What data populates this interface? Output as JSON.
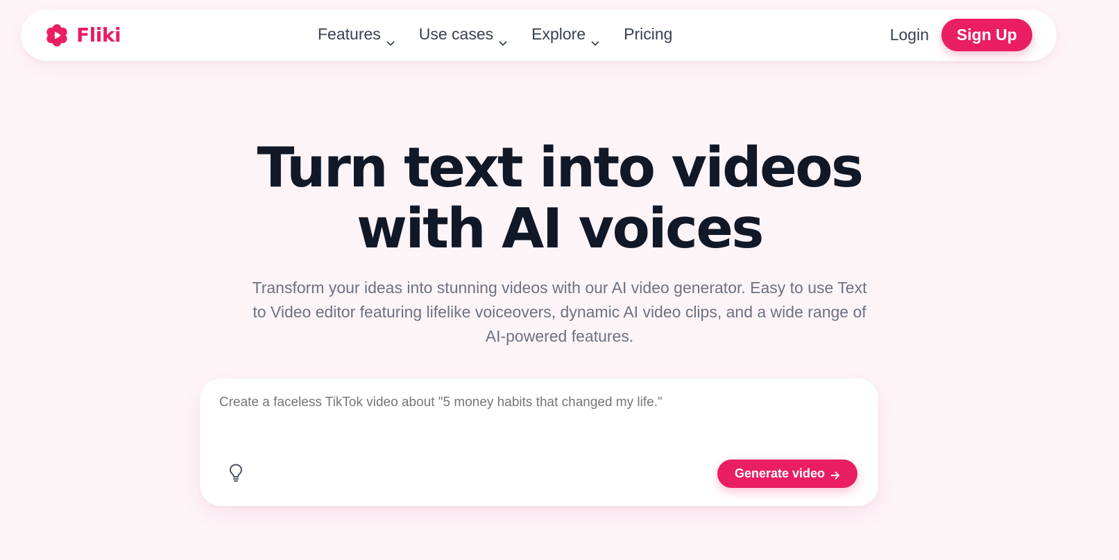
{
  "brand": {
    "name": "Fliki",
    "icon": "fliki-logo-icon",
    "color": "#e91e63"
  },
  "nav": {
    "items": [
      {
        "label": "Features",
        "has_dropdown": true
      },
      {
        "label": "Use cases",
        "has_dropdown": true
      },
      {
        "label": "Explore",
        "has_dropdown": true
      },
      {
        "label": "Pricing",
        "has_dropdown": false
      }
    ],
    "login_label": "Login",
    "signup_label": "Sign Up"
  },
  "hero": {
    "title_line1": "Turn text into videos",
    "title_line2": "with AI voices",
    "subtitle": "Transform your ideas into stunning videos with our AI video generator. Easy to use Text to Video editor featuring lifelike voiceovers, dynamic AI video clips, and a wide range of AI-powered features."
  },
  "prompt": {
    "placeholder": "Create a faceless TikTok video about \"5 money habits that changed my life.\"",
    "idea_icon": "lightbulb-icon",
    "generate_label": "Generate video",
    "generate_icon": "arrow-right-icon"
  },
  "colors": {
    "accent": "#e91e63",
    "background": "#fdf4f8",
    "heading": "#111827",
    "body_text": "#6b7280",
    "nav_text": "#374151"
  }
}
